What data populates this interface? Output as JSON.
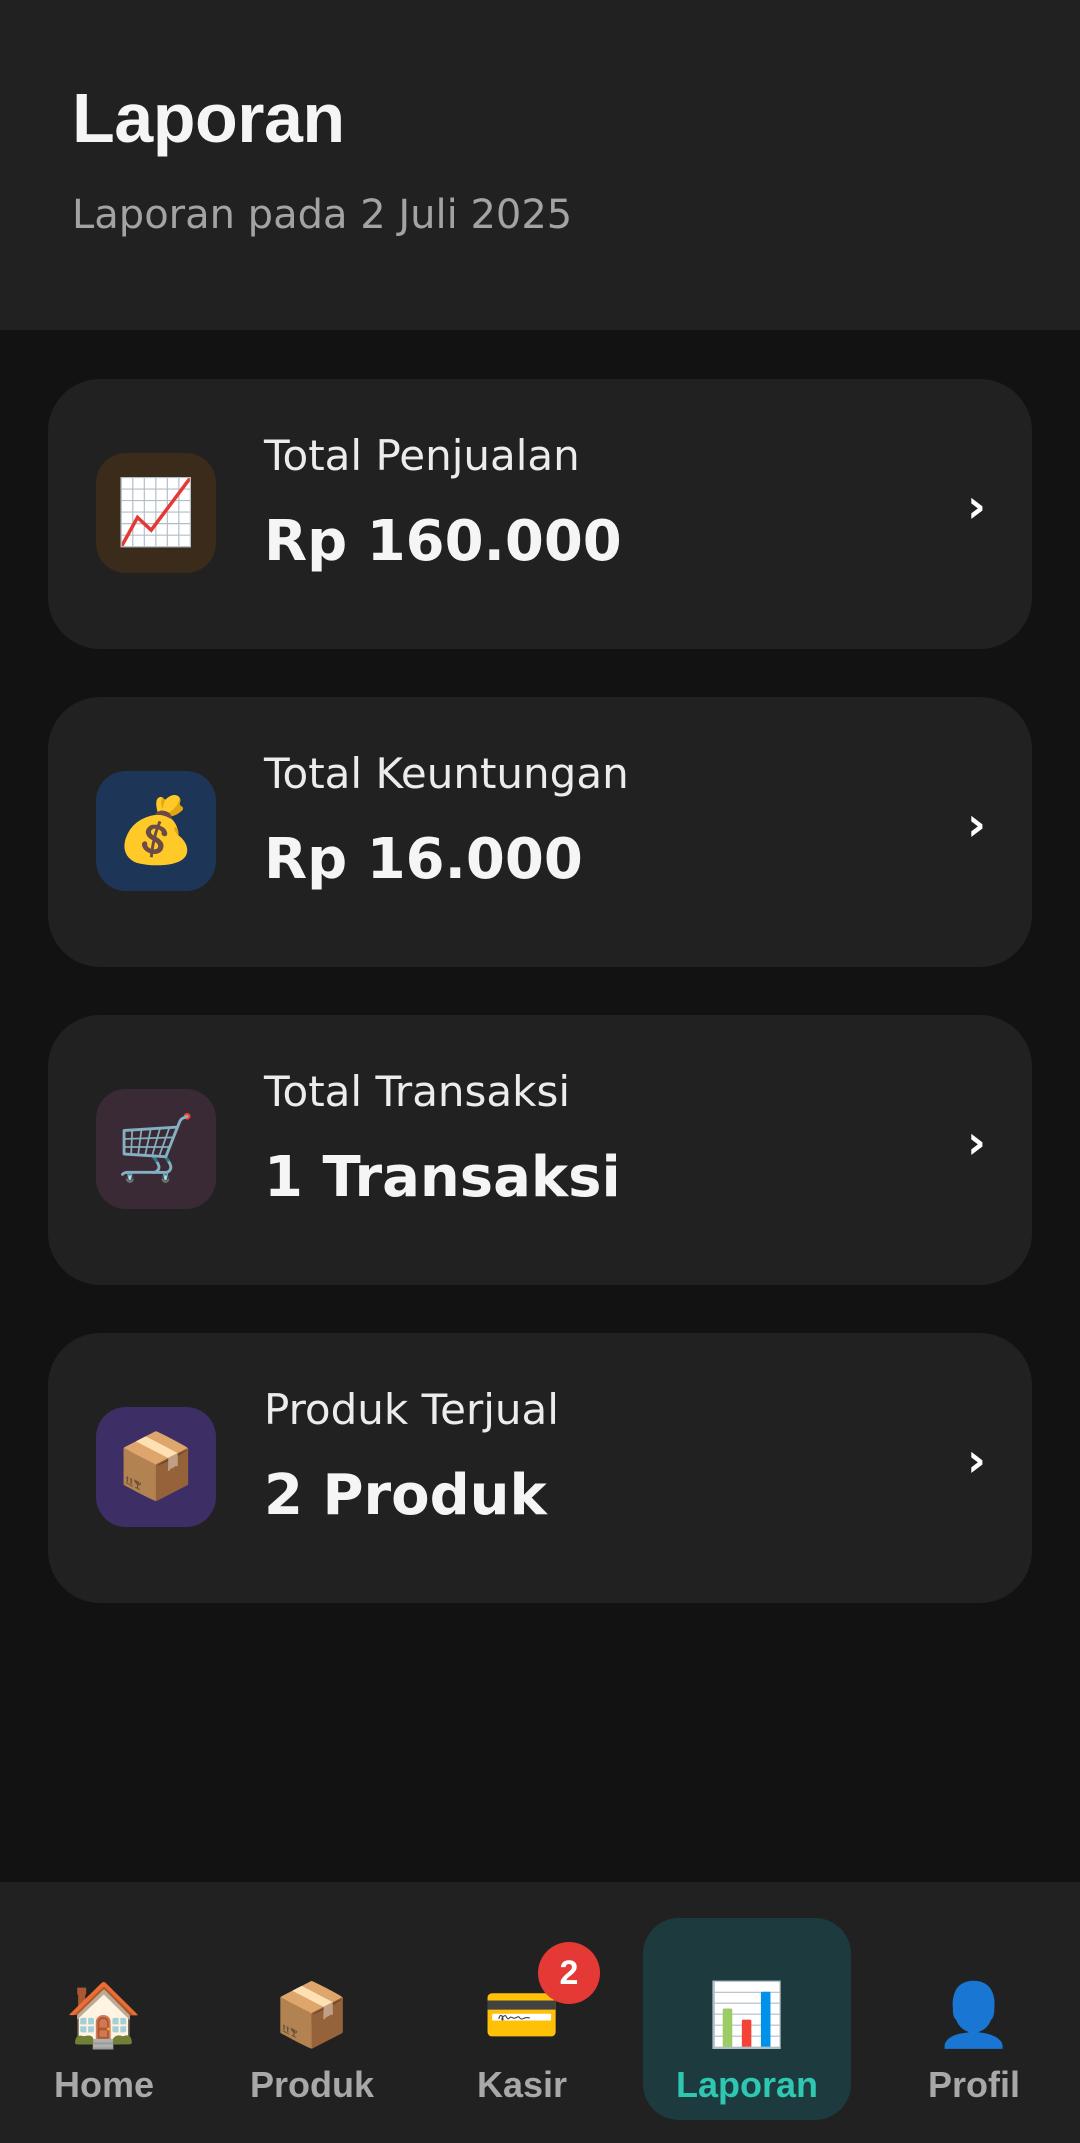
{
  "header": {
    "title": "Laporan",
    "subtitle": "Laporan pada 2 Juli 2025"
  },
  "cards": [
    {
      "label": "Total Penjualan",
      "value": "Rp 160.000",
      "icon": "chart-increasing-icon",
      "glyph": "📈",
      "icon_bg": "#3b2b1a"
    },
    {
      "label": "Total Keuntungan",
      "value": "Rp 16.000",
      "icon": "money-bag-icon",
      "glyph": "💰",
      "icon_bg": "#1d3557"
    },
    {
      "label": "Total Transaksi",
      "value": "1 Transaksi",
      "icon": "shopping-cart-icon",
      "glyph": "🛒",
      "icon_bg": "#3a2a35"
    },
    {
      "label": "Produk Terjual",
      "value": "2 Produk",
      "icon": "package-icon",
      "glyph": "📦",
      "icon_bg": "#3d2f66"
    }
  ],
  "chevron": "›",
  "nav": {
    "items": [
      {
        "label": "Home",
        "icon": "home-icon",
        "glyph": "🏠"
      },
      {
        "label": "Produk",
        "icon": "package-icon",
        "glyph": "📦"
      },
      {
        "label": "Kasir",
        "icon": "credit-card-icon",
        "glyph": "💳",
        "badge": "2"
      },
      {
        "label": "Laporan",
        "icon": "bar-chart-icon",
        "glyph": "📊",
        "active": true
      },
      {
        "label": "Profil",
        "icon": "user-icon",
        "glyph": "👤"
      }
    ]
  },
  "colors": {
    "background": "#121212",
    "surface": "#212121",
    "accent": "#2fc6b2",
    "active_nav_bg": "#1d3b3e",
    "badge": "#e53935"
  }
}
